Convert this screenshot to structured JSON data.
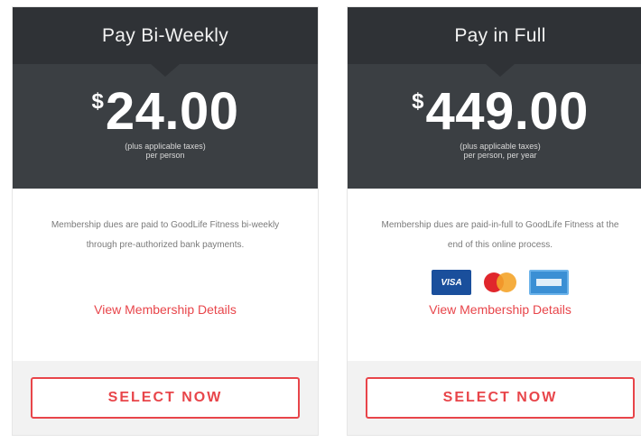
{
  "plans": [
    {
      "title": "Pay Bi-Weekly",
      "currency": "$",
      "amount": "24.00",
      "note_line1": "(plus applicable taxes)",
      "note_line2": "per person",
      "description": "Membership dues are paid to GoodLife Fitness bi-weekly through pre-authorized bank payments.",
      "details_link": "View Membership Details",
      "button": "SELECT NOW"
    },
    {
      "title": "Pay in Full",
      "currency": "$",
      "amount": "449.00",
      "note_line1": "(plus applicable taxes)",
      "note_line2": "per person, per year",
      "description": "Membership dues are paid-in-full to GoodLife Fitness at the end of this online process.",
      "details_link": "View Membership Details",
      "button": "SELECT NOW",
      "payment_icons": [
        "visa-icon",
        "mastercard-icon",
        "amex-icon"
      ],
      "visa_label": "VISA"
    }
  ],
  "colors": {
    "header_bg": "#2f3236",
    "price_bg": "#3b3f43",
    "accent": "#e8454a",
    "footer_bg": "#f2f2f2"
  }
}
